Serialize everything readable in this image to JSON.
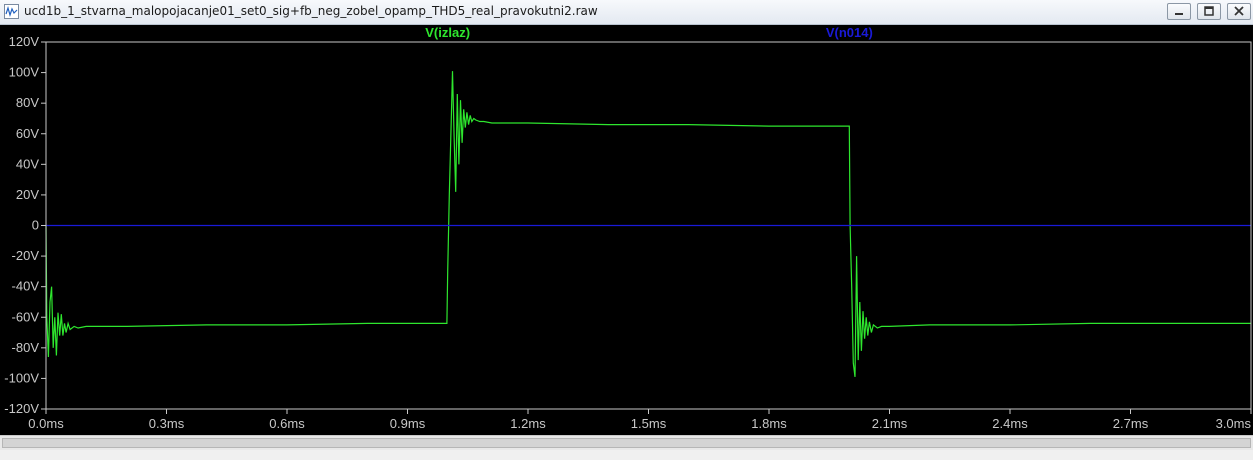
{
  "window": {
    "title": "ucd1b_1_stvarna_malopojacanje01_set0_sig+fb_neg_zobel_opamp_THD5_real_pravokutni2.raw",
    "icon": "waveform-file-icon",
    "controls": [
      "minimize-icon",
      "maximize-icon",
      "close-icon"
    ]
  },
  "colors": {
    "background": "#000000",
    "axis": "#c8c8c8",
    "trace_izlaz": "#2ee62e",
    "trace_n014": "#1a1ad8"
  },
  "chart_data": {
    "type": "line",
    "legend_placement": "top",
    "x_unit": "ms",
    "y_unit": "V",
    "xlim": [
      0.0,
      3.0
    ],
    "ylim": [
      -120,
      120
    ],
    "xticks": [
      0.0,
      0.3,
      0.6,
      0.9,
      1.2,
      1.5,
      1.8,
      2.1,
      2.4,
      2.7,
      3.0
    ],
    "xtick_labels": [
      "0.0ms",
      "0.3ms",
      "0.6ms",
      "0.9ms",
      "1.2ms",
      "1.5ms",
      "1.8ms",
      "2.1ms",
      "2.4ms",
      "2.7ms",
      "3.0ms"
    ],
    "yticks": [
      120,
      100,
      80,
      60,
      40,
      20,
      0,
      -20,
      -40,
      -60,
      -80,
      -100,
      -120
    ],
    "ytick_labels": [
      "120V",
      "100V",
      "80V",
      "60V",
      "40V",
      "20V",
      "0",
      "-20V",
      "-40V",
      "-60V",
      "-80V",
      "-100V",
      "-120V"
    ],
    "grid": false,
    "series": [
      {
        "name": "V(izlaz)",
        "color": "#2ee62e",
        "x": [
          0.0,
          0.002,
          0.006,
          0.01,
          0.014,
          0.018,
          0.022,
          0.026,
          0.03,
          0.034,
          0.038,
          0.042,
          0.046,
          0.05,
          0.055,
          0.06,
          0.07,
          0.08,
          0.1,
          0.2,
          0.4,
          0.6,
          0.8,
          0.998,
          1.0,
          1.004,
          1.008,
          1.012,
          1.016,
          1.02,
          1.024,
          1.028,
          1.032,
          1.036,
          1.04,
          1.044,
          1.048,
          1.052,
          1.056,
          1.06,
          1.065,
          1.07,
          1.08,
          1.09,
          1.11,
          1.2,
          1.4,
          1.6,
          1.8,
          2.0,
          2.002,
          2.006,
          2.01,
          2.014,
          2.018,
          2.022,
          2.026,
          2.03,
          2.034,
          2.038,
          2.042,
          2.046,
          2.05,
          2.055,
          2.06,
          2.07,
          2.08,
          2.1,
          2.2,
          2.4,
          2.6,
          2.8,
          3.0
        ],
        "y": [
          0,
          -60,
          -86,
          -50,
          -40,
          -80,
          -60,
          -85,
          -57,
          -72,
          -58,
          -72,
          -64,
          -70,
          -64,
          -68,
          -66,
          -67,
          -66,
          -66,
          -65,
          -65,
          -64,
          -64,
          -30,
          20,
          60,
          101,
          58,
          22,
          86,
          40,
          82,
          54,
          76,
          64,
          74,
          66,
          72,
          68,
          70,
          69,
          68,
          68,
          67,
          67,
          66,
          66,
          65,
          65,
          0,
          -40,
          -90,
          -99,
          -20,
          -88,
          -50,
          -82,
          -56,
          -74,
          -60,
          -72,
          -63,
          -70,
          -65,
          -67,
          -66,
          -66,
          -65,
          -65,
          -64,
          -64,
          -64
        ]
      },
      {
        "name": "V(n014)",
        "color": "#1a1ad8",
        "x": [
          0.0,
          3.0
        ],
        "y": [
          0,
          0
        ]
      }
    ]
  }
}
